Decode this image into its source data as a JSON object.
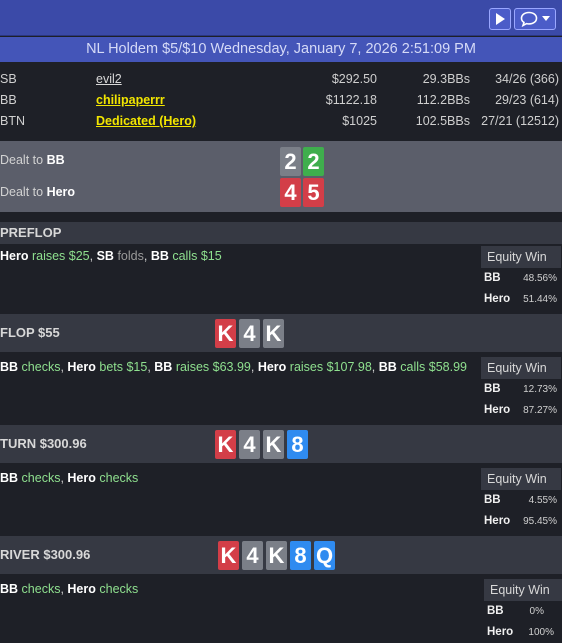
{
  "toolbar": {
    "play_icon": "play-icon",
    "chat_icon": "chat-bubble-icon"
  },
  "title": "NL Holdem $5/$10 Wednesday, January 7, 2026 2:51:09 PM",
  "players": [
    {
      "pos": "SB",
      "name": "evil2",
      "stack": "$292.50",
      "bbs": "29.3BBs",
      "stats": "34/26 (366)"
    },
    {
      "pos": "BB",
      "name": "chilipaperrr",
      "stack": "$1122.18",
      "bbs": "112.2BBs",
      "stats": "29/23 (614)"
    },
    {
      "pos": "BTN",
      "name": "Dedicated (Hero)",
      "stack": "$1025",
      "bbs": "102.5BBs",
      "stats": "27/21 (12512)"
    }
  ],
  "dealt": [
    {
      "prefix": "Dealt to ",
      "who": "BB",
      "cards": [
        "2",
        "2"
      ]
    },
    {
      "prefix": "Dealt to ",
      "who": "Hero",
      "cards": [
        "4",
        "5"
      ]
    }
  ],
  "colors": {
    "green": "#3fae4d",
    "red": "#d33e48",
    "gray": "#7b7f88",
    "blue": "#2f8bf0"
  },
  "streets": {
    "preflop": {
      "name": "PREFLOP",
      "action": {
        "a1": "Hero",
        "a2": " raises ",
        "a3": "$25",
        "a4": ", ",
        "a5": "SB",
        "a6": " folds",
        "a7": ", ",
        "a8": "BB",
        "a9": " calls ",
        "a10": "$15"
      },
      "equity": {
        "header": "Equity Win",
        "p1": "BB",
        "v1": "48.56%",
        "p2": "Hero",
        "v2": "51.44%"
      }
    },
    "flop": {
      "name": "FLOP $55",
      "board": [
        "K",
        "4",
        "K"
      ],
      "action": {
        "a1": "BB",
        "a2": " checks",
        "a3": ", ",
        "a4": "Hero",
        "a5": " bets ",
        "a6": "$15",
        "a7": ", ",
        "a8": "BB",
        "a9": " raises ",
        "a10": "$63.99",
        "a11": ", ",
        "a12": "Hero",
        "a13": " raises ",
        "a14": "$107.98",
        "a15": ", ",
        "a16": "BB",
        "a17": " calls ",
        "a18": "$58.99"
      },
      "equity": {
        "header": "Equity Win",
        "p1": "BB",
        "v1": "12.73%",
        "p2": "Hero",
        "v2": "87.27%"
      }
    },
    "turn": {
      "name": "TURN $300.96",
      "board": [
        "K",
        "4",
        "K",
        "8"
      ],
      "action": {
        "a1": "BB",
        "a2": " checks",
        "a3": ", ",
        "a4": "Hero",
        "a5": " checks"
      },
      "equity": {
        "header": "Equity Win",
        "p1": "BB",
        "v1": "4.55%",
        "p2": "Hero",
        "v2": "95.45%"
      }
    },
    "river": {
      "name": "RIVER $300.96",
      "board": [
        "K",
        "4",
        "K",
        "8",
        "Q"
      ],
      "action": {
        "a1": "BB",
        "a2": " checks",
        "a3": ", ",
        "a4": "Hero",
        "a5": " checks"
      },
      "equity": {
        "header": "Equity Win",
        "p1": "BB",
        "v1": "0%",
        "p2": "Hero",
        "v2": "100%"
      }
    }
  }
}
